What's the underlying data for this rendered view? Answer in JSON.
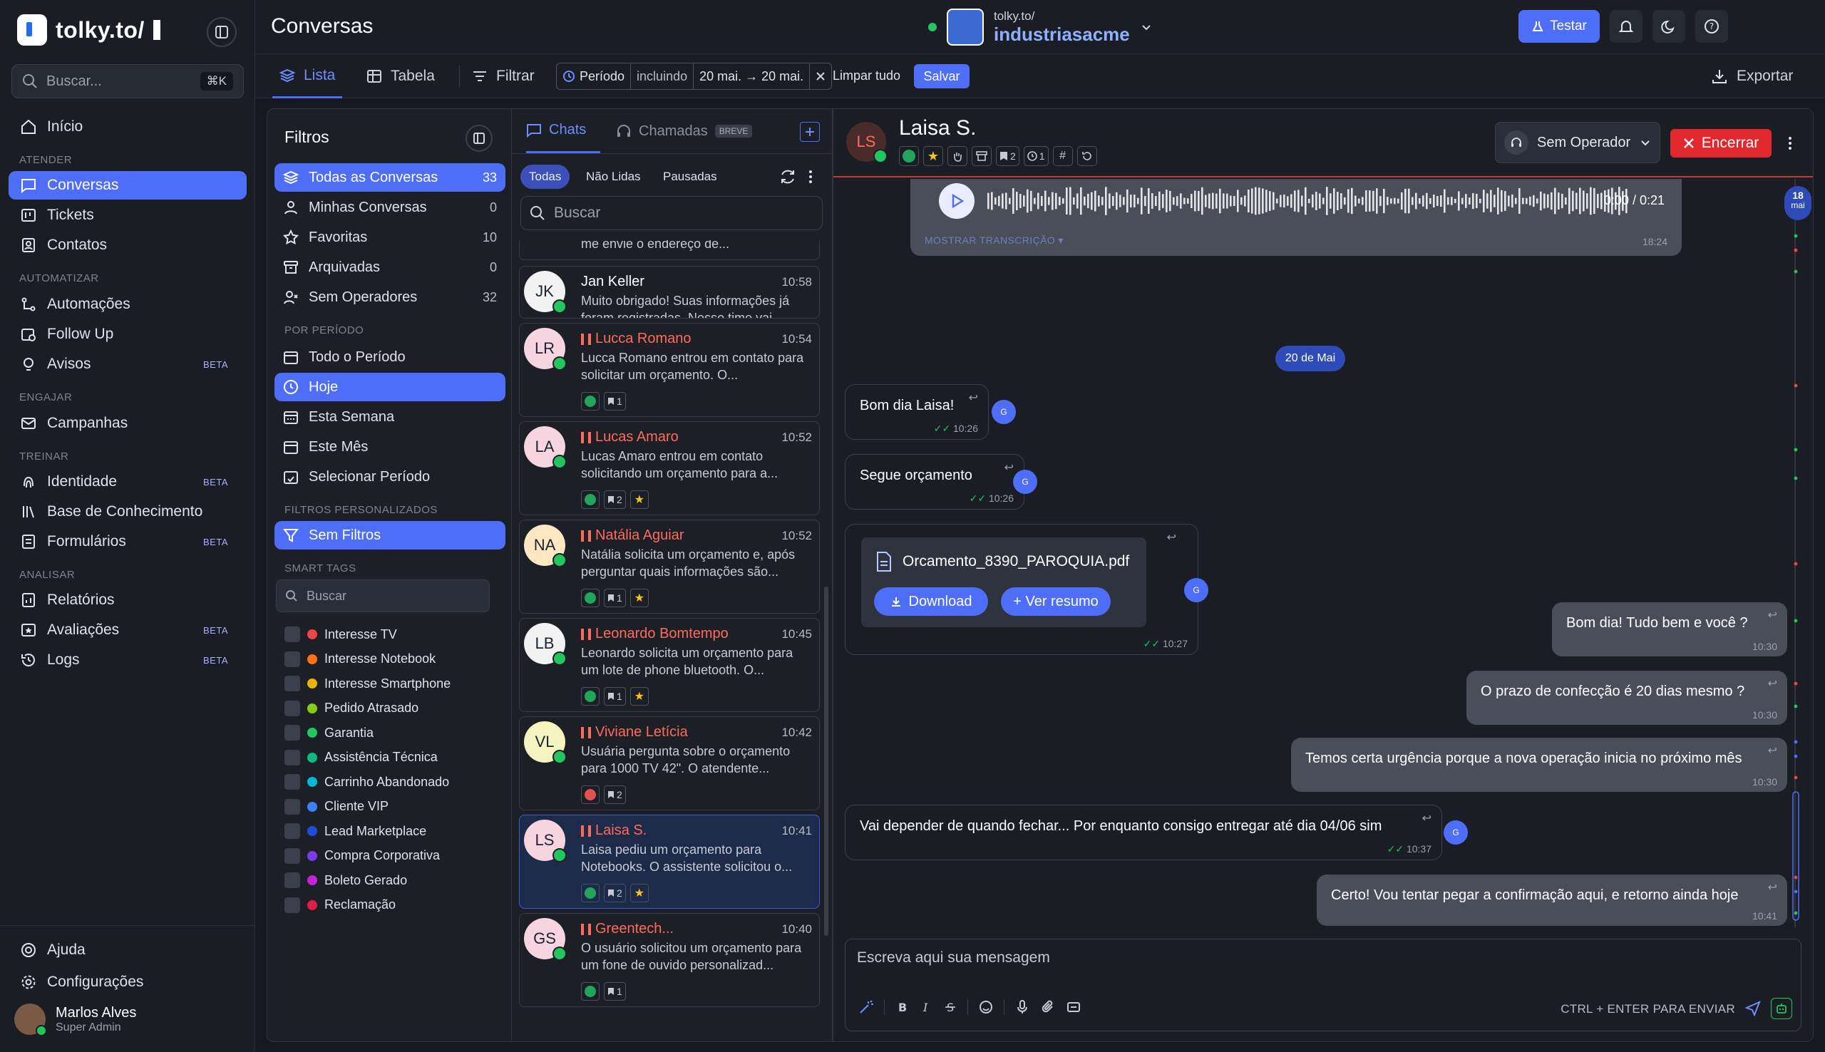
{
  "brand": {
    "name": "tolky.to/"
  },
  "search": {
    "placeholder": "Buscar...",
    "shortcut": "⌘K"
  },
  "nav": {
    "home": "Início",
    "sections": {
      "atender": "ATENDER",
      "automatizar": "AUTOMATIZAR",
      "engajar": "ENGAJAR",
      "treinar": "TREINAR",
      "analisar": "ANALISAR"
    },
    "items": {
      "conversas": "Conversas",
      "tickets": "Tickets",
      "contatos": "Contatos",
      "automacoes": "Automações",
      "followup": "Follow Up",
      "avisos": "Avisos",
      "campanhas": "Campanhas",
      "identidade": "Identidade",
      "base": "Base de Conhecimento",
      "formularios": "Formulários",
      "relatorios": "Relatórios",
      "avaliacoes": "Avaliações",
      "logs": "Logs",
      "ajuda": "Ajuda",
      "configuracoes": "Configurações"
    },
    "beta": "BETA"
  },
  "user": {
    "name": "Marlos Alves",
    "role": "Super Admin"
  },
  "topbar": {
    "title": "Conversas",
    "workspace_small": "tolky.to/",
    "workspace_name": "industriasacme",
    "testar": "Testar"
  },
  "toolbar": {
    "lista": "Lista",
    "tabela": "Tabela",
    "filtrar": "Filtrar",
    "periodo": "Período",
    "incluindo": "incluindo",
    "range": "20 mai. → 20 mai.",
    "limpar": "Limpar tudo",
    "salvar": "Salvar",
    "exportar": "Exportar"
  },
  "filters": {
    "title": "Filtros",
    "all": {
      "label": "Todas as Conversas",
      "count": "33"
    },
    "mine": {
      "label": "Minhas Conversas",
      "count": "0"
    },
    "fav": {
      "label": "Favoritas",
      "count": "10"
    },
    "arch": {
      "label": "Arquivadas",
      "count": "0"
    },
    "noop": {
      "label": "Sem Operadores",
      "count": "32"
    },
    "sec_period": "POR PERÍODO",
    "periods": [
      "Todo o Período",
      "Hoje",
      "Esta Semana",
      "Este Mês",
      "Selecionar Período"
    ],
    "sec_custom": "FILTROS PERSONALIZADOS",
    "custom": "Sem Filtros",
    "sec_tags": "SMART TAGS",
    "tag_search": "Buscar",
    "tags": [
      {
        "label": "Interesse TV",
        "color": "#ef4444"
      },
      {
        "label": "Interesse Notebook",
        "color": "#f97316"
      },
      {
        "label": "Interesse Smartphone",
        "color": "#eab308"
      },
      {
        "label": "Pedido Atrasado",
        "color": "#84cc16"
      },
      {
        "label": "Garantia",
        "color": "#22c55e"
      },
      {
        "label": "Assistência Técnica",
        "color": "#10b981"
      },
      {
        "label": "Carrinho Abandonado",
        "color": "#06b6d4"
      },
      {
        "label": "Cliente VIP",
        "color": "#3b82f6"
      },
      {
        "label": "Lead Marketplace",
        "color": "#1d4ed8"
      },
      {
        "label": "Compra Corporativa",
        "color": "#7c3aed"
      },
      {
        "label": "Boleto Gerado",
        "color": "#c026d3"
      },
      {
        "label": "Reclamação",
        "color": "#e11d48"
      }
    ]
  },
  "chatlist": {
    "tab_chats": "Chats",
    "tab_calls": "Chamadas",
    "breve": "BREVE",
    "seg": [
      "Todas",
      "Não Lidas",
      "Pausadas"
    ],
    "search": "Buscar",
    "partial": "Perfeito, Celismar! Agora, por gentileza, me envie o endereço de...",
    "cards": [
      {
        "initials": "JK",
        "name": "Jan Keller",
        "time": "10:58",
        "msg": "Muito obrigado! Suas informações já foram registradas. Nosso time vai...",
        "paused": false,
        "bg": "#f2f2f2",
        "b2": "",
        "star": false,
        "red": false
      },
      {
        "initials": "LR",
        "name": "Lucca Romano",
        "time": "10:54",
        "msg": "Lucca Romano entrou em contato para solicitar um orçamento. O...",
        "paused": true,
        "bg": "#f6d4e0",
        "b2": "1",
        "star": false,
        "red": false
      },
      {
        "initials": "LA",
        "name": "Lucas Amaro",
        "time": "10:52",
        "msg": "Lucas Amaro entrou em contato solicitando um orçamento para a...",
        "paused": true,
        "bg": "#f6d4e0",
        "b2": "2",
        "star": true,
        "red": false
      },
      {
        "initials": "NA",
        "name": "Natália Aguiar",
        "time": "10:52",
        "msg": "Natália solicita um orçamento e, após perguntar quais informações são...",
        "paused": true,
        "bg": "#fde7c2",
        "b2": "1",
        "star": true,
        "red": false
      },
      {
        "initials": "LB",
        "name": "Leonardo Bomtempo",
        "time": "10:45",
        "msg": "Leonardo solicita um orçamento para um lote de phone bluetooth. O...",
        "paused": true,
        "bg": "#f2f2f2",
        "b2": "1",
        "star": true,
        "red": false
      },
      {
        "initials": "VL",
        "name": "Viviane Letícia",
        "time": "10:42",
        "msg": "Usuária pergunta sobre o orçamento para 1000 TV 42\". O atendente...",
        "paused": true,
        "bg": "#f5f3c0",
        "b2": "2",
        "star": false,
        "red": true
      },
      {
        "initials": "LS",
        "name": "Laisa S.",
        "time": "10:41",
        "msg": "Laisa pediu um orçamento para Notebooks. O assistente solicitou o...",
        "paused": true,
        "bg": "#f6d4e0",
        "b2": "2",
        "star": true,
        "red": false
      },
      {
        "initials": "GS",
        "name": "Greentech...",
        "time": "10:40",
        "msg": "O usuário solicitou um orçamento para um fone de ouvido personalizad...",
        "paused": true,
        "bg": "#f6d4e0",
        "b2": "1",
        "star": false,
        "red": false
      }
    ]
  },
  "conversation": {
    "initials": "LS",
    "name": "Laisa S.",
    "header_badges": {
      "tags": "2",
      "timer": "1"
    },
    "operator": "Sem Operador",
    "encerrar": "Encerrar",
    "audio_time": "0:00 / 0:21",
    "audio_label": "MOSTRAR TRANSCRIÇÃO",
    "audio_sent": "18:24",
    "date": "20 de Mai",
    "messages": [
      {
        "text": "Bom dia Laisa!",
        "time": "10:26"
      },
      {
        "text": "Segue orçamento",
        "time": "10:26"
      },
      {
        "text": "Bom dia! Tudo bem e você ?",
        "time": "10:30"
      },
      {
        "text": "O prazo de confecção é 20 dias mesmo ?",
        "time": "10:30"
      },
      {
        "text": "Temos certa urgência porque a nova operação inicia no próximo mês",
        "time": "10:30"
      },
      {
        "text": "Vai depender de quando fechar... Por enquanto consigo entregar até dia 04/06 sim",
        "time": "10:37"
      },
      {
        "text": "Certo! Vou tentar pegar a confirmação aqui, e retorno ainda hoje",
        "time": "10:41"
      }
    ],
    "file": {
      "name": "Orcamento_8390_PAROQUIA.pdf",
      "download": "Download",
      "summary": "+ Ver resumo",
      "time": "10:27"
    },
    "agent_initial": "G",
    "composer_placeholder": "Escreva aqui sua mensagem",
    "hint": "CTRL + ENTER PARA ENVIAR",
    "timeline_day": "18",
    "timeline_month": "mai"
  },
  "colors": {
    "accent": "#4f6ef7",
    "danger": "#e0282e",
    "whatsapp": "#22c55e"
  }
}
